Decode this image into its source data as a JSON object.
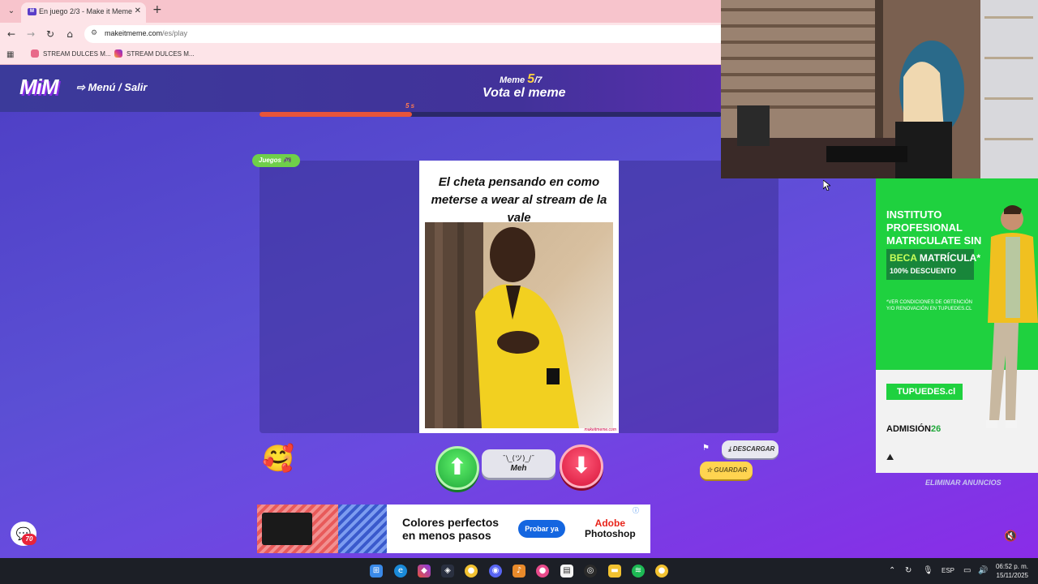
{
  "browser": {
    "tab_title": "En juego 2/3 - Make it Meme",
    "url_host": "makeitmeme.com",
    "url_path": "/es/play",
    "bookmarks": [
      {
        "label": "STREAM DULCES M...",
        "color": "#e86a8a"
      },
      {
        "label": "STREAM DULCES M...",
        "color": "#d8388a"
      }
    ]
  },
  "header": {
    "logo": "MiM",
    "menu_label": "⇨ Menú / Salir",
    "counter_prefix": "Meme",
    "counter_current": "5",
    "counter_total": "/7",
    "title": "Vota el meme"
  },
  "timer": {
    "label": "5 s",
    "fraction_remaining": 0.33
  },
  "meme": {
    "category_tag": "Juegos 🎮",
    "caption": "El cheta pensando en como meterse a wear al stream de la vale",
    "watermark": "makeitmeme.com"
  },
  "voting": {
    "up_icon": "arrow-up-icon",
    "meh_face": "¯\\_(ツ)_/¯",
    "meh_label": "Meh",
    "down_icon": "arrow-down-icon",
    "download_label": "DESCARGAR",
    "save_label": "GUARDAR",
    "emoji": "🥰"
  },
  "chat": {
    "badge": "70"
  },
  "ad_bottom": {
    "headline_1": "Colores perfectos",
    "headline_2": "en menos pasos",
    "cta": "Probar ya",
    "brand_1": "Adobe",
    "brand_2": "Photoshop"
  },
  "ad_side": {
    "title": "INSTITUTO PROFESIONAL MATRICULATE SIN PAES",
    "beca_a": "BECA",
    "beca_b": "MATRÍCULA*",
    "discount": "100% DESCUENTO",
    "note": "*VER CONDICIONES DE OBTENCIÓN Y/O RENOVACIÓN EN TUPUEDES.CL",
    "url": "TUPUEDES.cl",
    "admission_a": "ADMISIÓN",
    "admission_b": "26",
    "remove_ads": "ELIMINAR ANUNCIOS"
  },
  "taskbar": {
    "lang": "ESP",
    "time": "06:52 p. m.",
    "date": "15/11/2025"
  },
  "colors": {
    "accent_green": "#1fd13f",
    "vote_up": "#2bc04a",
    "vote_down": "#e8244a",
    "timer": "#e8543a"
  }
}
